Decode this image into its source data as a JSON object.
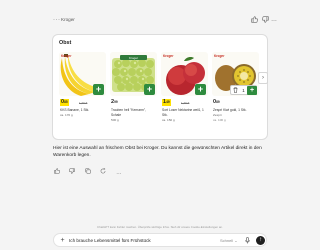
{
  "header": {
    "menu_icon": "more-dots-icon",
    "label": "Kroger",
    "icons": [
      "thumbs-up-icon",
      "thumbs-down-icon",
      "more-icon"
    ]
  },
  "card": {
    "title": "Obst",
    "products": [
      {
        "brand": "Kroger",
        "price": "0",
        "price_cents": "85",
        "old_price": "1,39 €",
        "sale": true,
        "name": "KKS Banane, 1 Stk.",
        "unit": "ca. 170 g",
        "unit2": "",
        "action": "add"
      },
      {
        "brand": "Kroger",
        "price": "2",
        "price_cents": "99",
        "old_price": "",
        "sale": false,
        "name": "Trauben hell \"Kernarm\", Schale",
        "unit": "500 g",
        "unit2": "",
        "action": "add"
      },
      {
        "brand": "Kroger",
        "price": "1",
        "price_cents": "49",
        "old_price": "1,79 €",
        "sale": true,
        "name": "Sort Loser Nektarine weiß, 1 Stk.",
        "unit": "ca. 150 g",
        "unit2": "",
        "action": "add"
      },
      {
        "brand": "Kroger",
        "price": "0",
        "price_cents": "89",
        "old_price": "",
        "sale": false,
        "name": "Zespri Kiwi gold, 1 Stk.",
        "unit": "Zespri",
        "unit2": "ca. 100 g",
        "action": "stepper",
        "quantity": "1"
      }
    ],
    "scroll_icon": "chevron-right-icon"
  },
  "message": {
    "text": "Hier ist eine Auswahl an frischem Obst bei Kroger. Du kannst die gewünschten Artikel direkt in den Warenkorb legen."
  },
  "actions": [
    "thumbs-up-icon",
    "thumbs-down-icon",
    "copy-icon",
    "refresh-icon",
    "more-icon"
  ],
  "disclaimer": "ChatGPT kann Fehler machen. Überprüfe wichtige Infos. Sieh dir unsere Cookie-Einstellungen an.",
  "input": {
    "value": "Ich brauche Lebensmittel fürs Frühstück",
    "mode_label": "Schnell",
    "icons": [
      "plus-icon",
      "mic-icon",
      "send-icon"
    ]
  },
  "colors": {
    "accent_green": "#2e8b3e",
    "sale_yellow": "#ffe100",
    "card_bg": "#ffffff",
    "page_bg": "#f4f4f4"
  }
}
